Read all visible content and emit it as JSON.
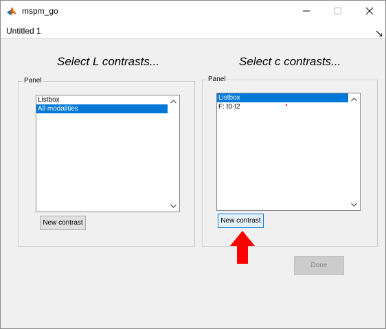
{
  "window": {
    "title": "mspm_go",
    "tab_label": "Untitled 1"
  },
  "headings": {
    "left": "Select L contrasts...",
    "right": "Select c contrasts..."
  },
  "left_panel": {
    "title": "Panel",
    "listbox": {
      "items": [
        {
          "label": "Listbox",
          "selected": false
        },
        {
          "label": "All modalities",
          "selected": true
        }
      ]
    },
    "button_label": "New contrast"
  },
  "right_panel": {
    "title": "Panel",
    "listbox": {
      "items": [
        {
          "label": "Listbox",
          "selected": true
        },
        {
          "label": "F: t0-t2",
          "selected": false
        }
      ]
    },
    "button_label": "New contrast"
  },
  "done_button": {
    "label": "Done",
    "enabled": false
  },
  "colors": {
    "selection": "#0078d7",
    "annotation_arrow": "#ff0000"
  },
  "icons": {
    "app": "matlab-icon",
    "minimize": "minimize-icon",
    "maximize": "maximize-icon",
    "close": "close-icon",
    "undock": "undock-arrow-icon",
    "scroll_up": "chevron-up-icon",
    "scroll_down": "chevron-down-icon"
  }
}
